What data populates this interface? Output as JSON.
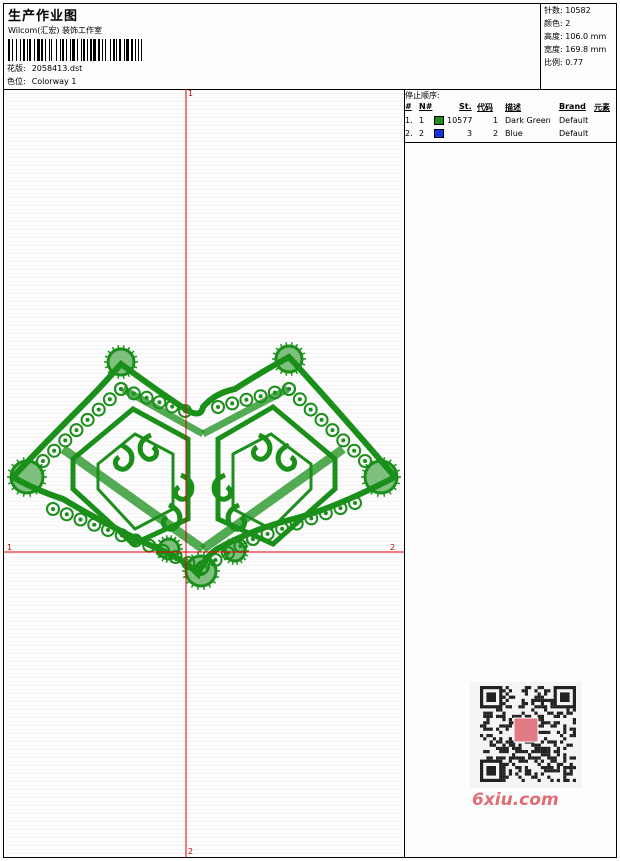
{
  "header": {
    "title": "生产作业图",
    "company": "Wilcom(汇宏) 装饰工作室",
    "design_label": "花版:",
    "design_file": "2058413.dst",
    "colorway_label": "色位:",
    "colorway": "Colorway 1"
  },
  "stats": {
    "stitches": "针数: 10582",
    "colors": "颜色: 2",
    "height": "高度: 106.0 mm",
    "width": "宽度: 169.8 mm",
    "scale": "比例: 0.77"
  },
  "preview": {
    "axis_top": "1",
    "axis_bottom": "2",
    "axis_left": "1",
    "axis_right": "2"
  },
  "sequence": {
    "title": "停止顺序:",
    "columns": [
      "#",
      "N#",
      "St.",
      "代码",
      "描述",
      "Brand",
      "元素"
    ],
    "rows": [
      {
        "index": "1.",
        "needle": "1",
        "stitches": "10577",
        "code": "1",
        "description": "Dark Green",
        "brand": "Default",
        "color": "#1a8f1a"
      },
      {
        "index": "2.",
        "needle": "2",
        "stitches": "3",
        "code": "2",
        "description": "Blue",
        "brand": "Default",
        "color": "#1530e0"
      }
    ]
  },
  "colors": {
    "embroidery": "#1a8f1a",
    "axis": "#e00000"
  },
  "watermark": {
    "text": "6xiu.com"
  }
}
